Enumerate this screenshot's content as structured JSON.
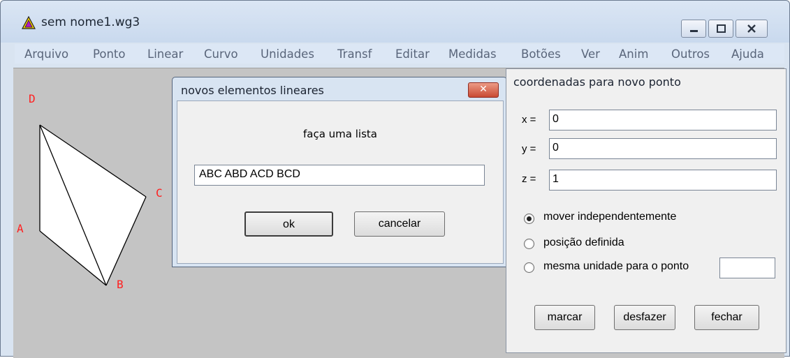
{
  "window": {
    "title": "sem nome1.wg3",
    "icon": "wingeom-triangle-icon"
  },
  "menu": [
    {
      "label": "Arquivo",
      "key": "arquivo"
    },
    {
      "label": "Ponto",
      "key": "ponto"
    },
    {
      "label": "Linear",
      "key": "linear"
    },
    {
      "label": "Curvo",
      "key": "curvo"
    },
    {
      "label": "Unidades",
      "key": "unidades"
    },
    {
      "label": "Transf",
      "key": "transf"
    },
    {
      "label": "Editar",
      "key": "editar"
    },
    {
      "label": "Medidas",
      "key": "medidas"
    },
    {
      "label": "Botões",
      "key": "botoes"
    },
    {
      "label": "Ver",
      "key": "ver"
    },
    {
      "label": "Anim",
      "key": "anim"
    },
    {
      "label": "Outros",
      "key": "outros"
    },
    {
      "label": "Ajuda",
      "key": "ajuda"
    }
  ],
  "canvas": {
    "points": [
      {
        "label": "D"
      },
      {
        "label": "C"
      },
      {
        "label": "A"
      },
      {
        "label": "B"
      }
    ],
    "label_color": "#ff2020",
    "background_color": "#c4c4c4"
  },
  "linear_dialog": {
    "title": "novos elementos lineares",
    "prompt": "faça uma lista",
    "input_value": "ABC ABD ACD BCD",
    "ok_label": "ok",
    "cancel_label": "cancelar"
  },
  "coord_panel": {
    "title": "coordenadas para novo ponto",
    "fields": [
      {
        "label": "x =",
        "value": "0"
      },
      {
        "label": "y =",
        "value": "0"
      },
      {
        "label": "z =",
        "value": "1"
      }
    ],
    "options": [
      {
        "label": "mover independentemente",
        "selected": true
      },
      {
        "label": "posição definida",
        "selected": false
      },
      {
        "label": "mesma unidade para o ponto",
        "selected": false
      }
    ],
    "unit_point_value": "",
    "buttons": {
      "mark": "marcar",
      "undo": "desfazer",
      "close": "fechar"
    }
  }
}
